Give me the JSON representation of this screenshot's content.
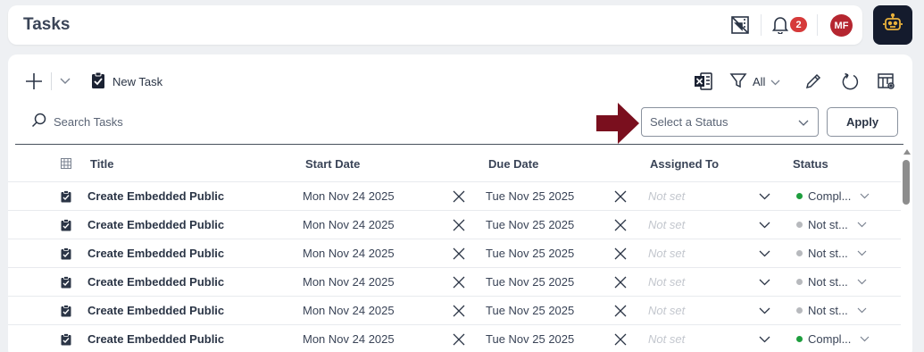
{
  "header": {
    "title": "Tasks",
    "notification_count": "2",
    "avatar_initials": "MF",
    "icons": [
      "ruler-layout-icon",
      "bell-icon",
      "bot-icon"
    ]
  },
  "toolbar": {
    "new_task_label": "New Task",
    "filter_label": "All",
    "icons": [
      "plus-icon",
      "chevron-down-icon",
      "clipboard-icon",
      "excel-export-icon",
      "filter-icon",
      "pencil-icon",
      "refresh-icon",
      "table-settings-icon"
    ]
  },
  "search": {
    "placeholder": "Search Tasks"
  },
  "status_filter": {
    "placeholder": "Select a Status",
    "apply_label": "Apply"
  },
  "table": {
    "columns": {
      "title": "Title",
      "start": "Start Date",
      "due": "Due Date",
      "assigned": "Assigned To",
      "status": "Status"
    },
    "rows": [
      {
        "title": "Create Embedded Public",
        "start": "Mon Nov 24 2025",
        "due": "Tue Nov 25 2025",
        "assigned": "Not set",
        "status": "Compl...",
        "status_color": "#1e9e3e"
      },
      {
        "title": "Create Embedded Public",
        "start": "Mon Nov 24 2025",
        "due": "Tue Nov 25 2025",
        "assigned": "Not set",
        "status": "Not st...",
        "status_color": "#b7b9bd"
      },
      {
        "title": "Create Embedded Public",
        "start": "Mon Nov 24 2025",
        "due": "Tue Nov 25 2025",
        "assigned": "Not set",
        "status": "Not st...",
        "status_color": "#b7b9bd"
      },
      {
        "title": "Create Embedded Public",
        "start": "Mon Nov 24 2025",
        "due": "Tue Nov 25 2025",
        "assigned": "Not set",
        "status": "Not st...",
        "status_color": "#b7b9bd"
      },
      {
        "title": "Create Embedded Public",
        "start": "Mon Nov 24 2025",
        "due": "Tue Nov 25 2025",
        "assigned": "Not set",
        "status": "Not st...",
        "status_color": "#b7b9bd"
      },
      {
        "title": "Create Embedded Public",
        "start": "Mon Nov 24 2025",
        "due": "Tue Nov 25 2025",
        "assigned": "Not set",
        "status": "Compl...",
        "status_color": "#1e9e3e"
      }
    ]
  },
  "colors": {
    "accent_dark": "#141b2d",
    "badge_red": "#d63a3a",
    "avatar_red": "#b52630",
    "arrow": "#7a0f1e"
  }
}
